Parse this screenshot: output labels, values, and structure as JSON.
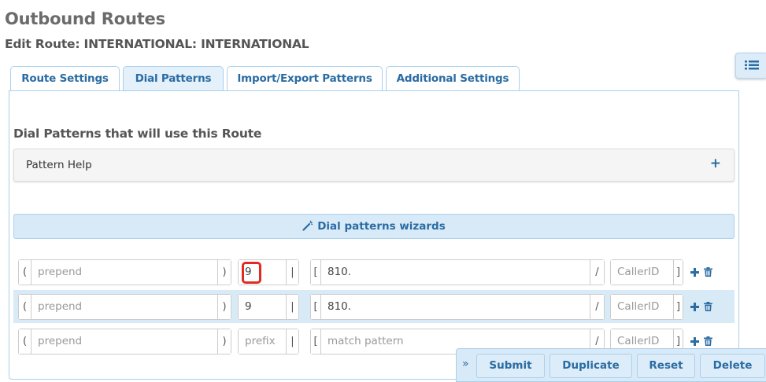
{
  "header": {
    "title": "Outbound Routes",
    "subtitle": "Edit Route: INTERNATIONAL: INTERNATIONAL"
  },
  "side_toggle": {
    "icon": "list-icon"
  },
  "tabs": [
    {
      "label": "Route Settings",
      "active": false
    },
    {
      "label": "Dial Patterns",
      "active": true
    },
    {
      "label": "Import/Export Patterns",
      "active": false
    },
    {
      "label": "Additional Settings",
      "active": false
    }
  ],
  "section": {
    "title": "Dial Patterns that will use this Route"
  },
  "pattern_help": {
    "label": "Pattern Help",
    "expand_symbol": "+"
  },
  "wizard": {
    "label": "Dial patterns wizards",
    "icon": "magic-wand-icon"
  },
  "pattern_rows": [
    {
      "prepend": {
        "value": "",
        "placeholder": "prepend"
      },
      "prefix": {
        "value": "9",
        "placeholder": "prefix"
      },
      "match": {
        "value": "810.",
        "placeholder": "match pattern"
      },
      "callerid": {
        "value": "",
        "placeholder": "CallerID"
      },
      "highlighted_field": "prefix"
    },
    {
      "prepend": {
        "value": "",
        "placeholder": "prepend"
      },
      "prefix": {
        "value": "9",
        "placeholder": "prefix"
      },
      "match": {
        "value": "810.",
        "placeholder": "match pattern"
      },
      "callerid": {
        "value": "",
        "placeholder": "CallerID"
      }
    },
    {
      "prepend": {
        "value": "",
        "placeholder": "prepend"
      },
      "prefix": {
        "value": "",
        "placeholder": "prefix"
      },
      "match": {
        "value": "",
        "placeholder": "match pattern"
      },
      "callerid": {
        "value": "",
        "placeholder": "CallerID"
      }
    }
  ],
  "delimiters": {
    "prepend_open": "(",
    "prepend_close": ")",
    "prefix_sep": "|",
    "match_open": "[",
    "match_sep": "/",
    "callerid_close": "]"
  },
  "actions": {
    "expand_symbol": "»",
    "submit": "Submit",
    "duplicate": "Duplicate",
    "reset": "Reset",
    "delete": "Delete"
  },
  "colors": {
    "accent": "#2b6ca3",
    "highlight": "#e02a24",
    "tab_active_bg": "#e4f0fa",
    "row_stripe": "#d9eaf7"
  }
}
